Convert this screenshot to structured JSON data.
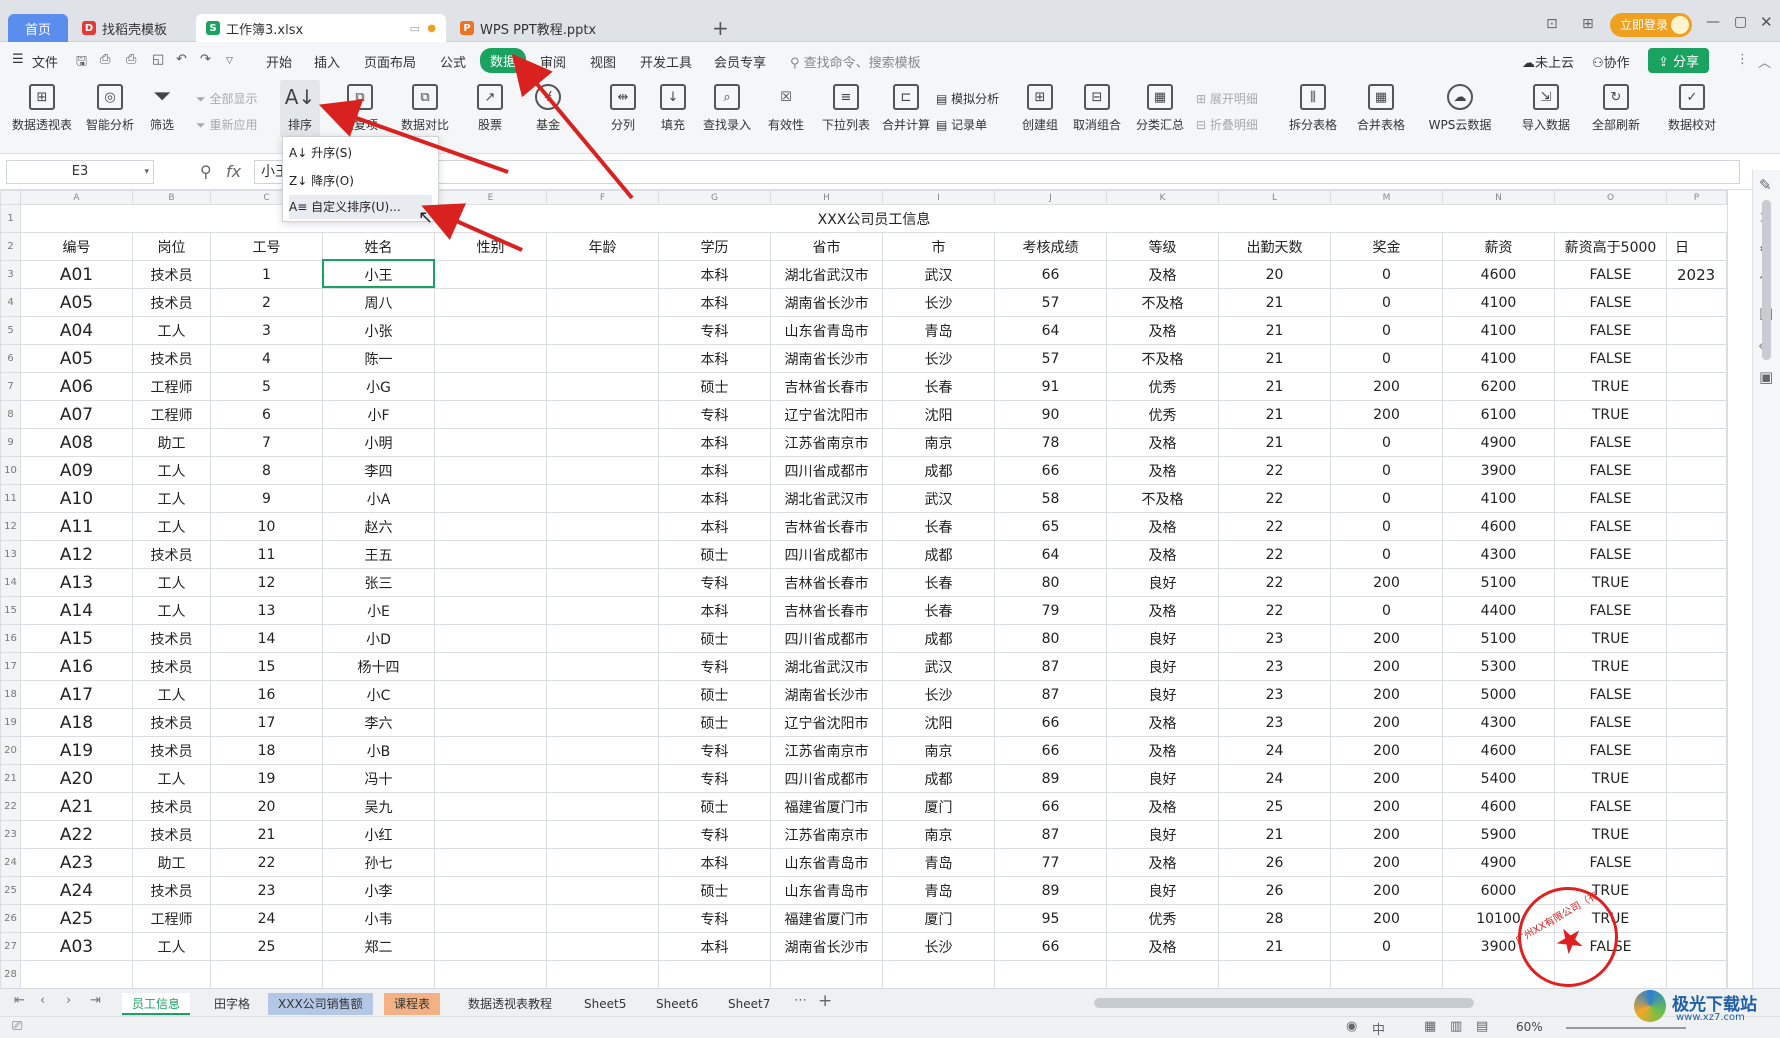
{
  "tabs": [
    {
      "label": "首页"
    },
    {
      "label": "找稻壳模板"
    },
    {
      "label": "工作簿3.xlsx"
    },
    {
      "label": "WPS PPT教程.pptx"
    }
  ],
  "window": {
    "login_label": "立即登录"
  },
  "menu": {
    "file": "文件",
    "items": [
      "开始",
      "插入",
      "页面布局",
      "公式",
      "数据",
      "审阅",
      "视图",
      "开发工具",
      "会员专享"
    ],
    "search_placeholder": "查找命令、搜索模板",
    "cloud": "未上云",
    "collab": "协作",
    "share": "分享"
  },
  "ribbon": {
    "pivot": "数据透视表",
    "smart": "智能分析",
    "filter": "筛选",
    "show_all": "全部显示",
    "reapply": "重新应用",
    "sort": "排序",
    "dup": "重复项",
    "compare": "数据对比",
    "stock": "股票",
    "fund": "基金",
    "split": "分列",
    "fill": "填充",
    "lookup": "查找录入",
    "validity": "有效性",
    "dropdown_list": "下拉列表",
    "merge_calc": "合并计算",
    "simulate": "模拟分析",
    "record": "记录单",
    "create_group": "创建组",
    "ungroup": "取消组合",
    "subtotal": "分类汇总",
    "expand": "展开明细",
    "collapse": "折叠明细",
    "split_table": "拆分表格",
    "merge_table": "合并表格",
    "wps_cloud": "WPS云数据",
    "import": "导入数据",
    "refresh_all": "全部刷新",
    "check": "数据校对"
  },
  "sort_menu": {
    "asc": "升序(S)",
    "desc": "降序(O)",
    "custom": "自定义排序(U)..."
  },
  "formula_bar": {
    "cell_ref": "E3",
    "fx": "fx",
    "content": "小王"
  },
  "columns": [
    "A",
    "B",
    "C",
    "D",
    "E",
    "F",
    "G",
    "H",
    "I",
    "J",
    "K",
    "L",
    "M",
    "N",
    "O",
    "P"
  ],
  "title": "XXX公司员工信息",
  "headers": [
    "编号",
    "岗位",
    "工号",
    "姓名",
    "性别",
    "年龄",
    "学历",
    "省市",
    "市",
    "考核成绩",
    "等级",
    "出勤天数",
    "奖金",
    "薪资",
    "薪资高于5000",
    "日"
  ],
  "rows": [
    [
      "A01",
      "技术员",
      "1",
      "小王",
      "",
      "",
      "本科",
      "湖北省武汉市",
      "武汉",
      "66",
      "及格",
      "20",
      "0",
      "4600",
      "FALSE",
      "2023"
    ],
    [
      "A05",
      "技术员",
      "2",
      "周八",
      "",
      "",
      "本科",
      "湖南省长沙市",
      "长沙",
      "57",
      "不及格",
      "21",
      "0",
      "4100",
      "FALSE",
      ""
    ],
    [
      "A04",
      "工人",
      "3",
      "小张",
      "",
      "",
      "专科",
      "山东省青岛市",
      "青岛",
      "64",
      "及格",
      "21",
      "0",
      "4100",
      "FALSE",
      ""
    ],
    [
      "A05",
      "技术员",
      "4",
      "陈一",
      "",
      "",
      "本科",
      "湖南省长沙市",
      "长沙",
      "57",
      "不及格",
      "21",
      "0",
      "4100",
      "FALSE",
      ""
    ],
    [
      "A06",
      "工程师",
      "5",
      "小G",
      "",
      "",
      "硕士",
      "吉林省长春市",
      "长春",
      "91",
      "优秀",
      "21",
      "200",
      "6200",
      "TRUE",
      ""
    ],
    [
      "A07",
      "工程师",
      "6",
      "小F",
      "",
      "",
      "专科",
      "辽宁省沈阳市",
      "沈阳",
      "90",
      "优秀",
      "21",
      "200",
      "6100",
      "TRUE",
      ""
    ],
    [
      "A08",
      "助工",
      "7",
      "小明",
      "",
      "",
      "本科",
      "江苏省南京市",
      "南京",
      "78",
      "及格",
      "21",
      "0",
      "4900",
      "FALSE",
      ""
    ],
    [
      "A09",
      "工人",
      "8",
      "李四",
      "",
      "",
      "本科",
      "四川省成都市",
      "成都",
      "66",
      "及格",
      "22",
      "0",
      "3900",
      "FALSE",
      ""
    ],
    [
      "A10",
      "工人",
      "9",
      "小A",
      "",
      "",
      "本科",
      "湖北省武汉市",
      "武汉",
      "58",
      "不及格",
      "22",
      "0",
      "4100",
      "FALSE",
      ""
    ],
    [
      "A11",
      "工人",
      "10",
      "赵六",
      "",
      "",
      "本科",
      "吉林省长春市",
      "长春",
      "65",
      "及格",
      "22",
      "0",
      "4600",
      "FALSE",
      ""
    ],
    [
      "A12",
      "技术员",
      "11",
      "王五",
      "",
      "",
      "硕士",
      "四川省成都市",
      "成都",
      "64",
      "及格",
      "22",
      "0",
      "4300",
      "FALSE",
      ""
    ],
    [
      "A13",
      "工人",
      "12",
      "张三",
      "",
      "",
      "专科",
      "吉林省长春市",
      "长春",
      "80",
      "良好",
      "22",
      "200",
      "5100",
      "TRUE",
      ""
    ],
    [
      "A14",
      "工人",
      "13",
      "小E",
      "",
      "",
      "本科",
      "吉林省长春市",
      "长春",
      "79",
      "及格",
      "22",
      "0",
      "4400",
      "FALSE",
      ""
    ],
    [
      "A15",
      "技术员",
      "14",
      "小D",
      "",
      "",
      "硕士",
      "四川省成都市",
      "成都",
      "80",
      "良好",
      "23",
      "200",
      "5100",
      "TRUE",
      ""
    ],
    [
      "A16",
      "技术员",
      "15",
      "杨十四",
      "",
      "",
      "专科",
      "湖北省武汉市",
      "武汉",
      "87",
      "良好",
      "23",
      "200",
      "5300",
      "TRUE",
      ""
    ],
    [
      "A17",
      "工人",
      "16",
      "小C",
      "",
      "",
      "硕士",
      "湖南省长沙市",
      "长沙",
      "87",
      "良好",
      "23",
      "200",
      "5000",
      "FALSE",
      ""
    ],
    [
      "A18",
      "技术员",
      "17",
      "李六",
      "",
      "",
      "硕士",
      "辽宁省沈阳市",
      "沈阳",
      "66",
      "及格",
      "23",
      "200",
      "4300",
      "FALSE",
      ""
    ],
    [
      "A19",
      "技术员",
      "18",
      "小B",
      "",
      "",
      "专科",
      "江苏省南京市",
      "南京",
      "66",
      "及格",
      "24",
      "200",
      "4600",
      "FALSE",
      ""
    ],
    [
      "A20",
      "工人",
      "19",
      "冯十",
      "",
      "",
      "专科",
      "四川省成都市",
      "成都",
      "89",
      "良好",
      "24",
      "200",
      "5400",
      "TRUE",
      ""
    ],
    [
      "A21",
      "技术员",
      "20",
      "吴九",
      "",
      "",
      "硕士",
      "福建省厦门市",
      "厦门",
      "66",
      "及格",
      "25",
      "200",
      "4600",
      "FALSE",
      ""
    ],
    [
      "A22",
      "技术员",
      "21",
      "小红",
      "",
      "",
      "专科",
      "江苏省南京市",
      "南京",
      "87",
      "良好",
      "21",
      "200",
      "5900",
      "TRUE",
      ""
    ],
    [
      "A23",
      "助工",
      "22",
      "孙七",
      "",
      "",
      "本科",
      "山东省青岛市",
      "青岛",
      "77",
      "及格",
      "26",
      "200",
      "4900",
      "FALSE",
      ""
    ],
    [
      "A24",
      "技术员",
      "23",
      "小李",
      "",
      "",
      "硕士",
      "山东省青岛市",
      "青岛",
      "89",
      "良好",
      "26",
      "200",
      "6000",
      "TRUE",
      ""
    ],
    [
      "A25",
      "工程师",
      "24",
      "小韦",
      "",
      "",
      "专科",
      "福建省厦门市",
      "厦门",
      "95",
      "优秀",
      "28",
      "200",
      "10100",
      "TRUE",
      ""
    ],
    [
      "A03",
      "工人",
      "25",
      "郑二",
      "",
      "",
      "本科",
      "湖南省长沙市",
      "长沙",
      "66",
      "及格",
      "21",
      "0",
      "3900",
      "FALSE",
      ""
    ]
  ],
  "sheet_tabs": [
    {
      "label": "员工信息",
      "color": "#ffffff"
    },
    {
      "label": "田字格",
      "color": ""
    },
    {
      "label": "XXX公司销售额",
      "color": "#b4c7e7"
    },
    {
      "label": "课程表",
      "color": "#f4b183"
    },
    {
      "label": "数据透视表教程",
      "color": ""
    },
    {
      "label": "Sheet5",
      "color": ""
    },
    {
      "label": "Sheet6",
      "color": ""
    },
    {
      "label": "Sheet7",
      "color": ""
    }
  ],
  "status": {
    "zoom": "60%"
  },
  "watermark": {
    "text": "极光下载站",
    "url": "www.xz7.com"
  },
  "stamp": {
    "text": "广州XX有限公司（有限公司）"
  },
  "colors": {
    "accent": "#1aa260",
    "login": "#f0a020",
    "arrow": "#d9221f"
  }
}
